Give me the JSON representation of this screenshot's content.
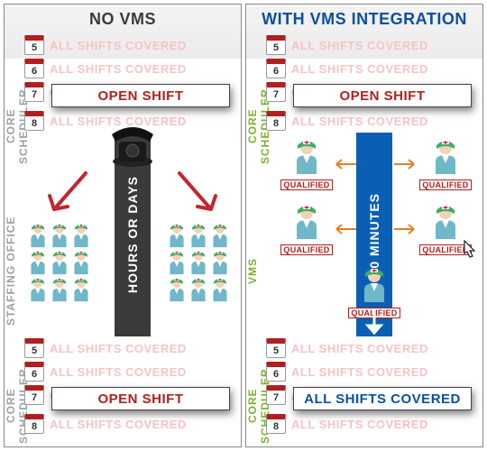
{
  "left": {
    "title": "NO VMS",
    "sideLabels": {
      "top": "CORE SCHEDULER",
      "mid": "STAFFING OFFICE",
      "bot": "CORE SCHEDULER"
    },
    "rowsTop": [
      {
        "day": "5",
        "text": "ALL SHIFTS COVERED"
      },
      {
        "day": "6",
        "text": "ALL SHIFTS COVERED"
      },
      {
        "day": "7",
        "text": "OPEN SHIFT"
      },
      {
        "day": "8",
        "text": "ALL SHIFTS COVERED"
      }
    ],
    "openLabel": "OPEN SHIFT",
    "pillarLabel": "HOURS OR DAYS",
    "rowsBot": [
      {
        "day": "5",
        "text": "ALL SHIFTS COVERED"
      },
      {
        "day": "6",
        "text": "ALL SHIFTS COVERED"
      },
      {
        "day": "7",
        "text": "OPEN SHIFT"
      },
      {
        "day": "8",
        "text": "ALL SHIFTS COVERED"
      }
    ],
    "openLabelBot": "OPEN SHIFT"
  },
  "right": {
    "title": "WITH VMS INTEGRATION",
    "sideLabels": {
      "top": "CORE SCHEDULER",
      "mid": "VMS",
      "bot": "CORE SCHEDULER"
    },
    "rowsTop": [
      {
        "day": "5",
        "text": "ALL SHIFTS COVERED"
      },
      {
        "day": "6",
        "text": "ALL SHIFTS COVERED"
      },
      {
        "day": "7",
        "text": "OPEN SHIFT"
      },
      {
        "day": "8",
        "text": "ALL SHIFTS COVERED"
      }
    ],
    "openLabel": "OPEN SHIFT",
    "pillarLabel": "10 MINUTES",
    "qualifiedLabel": "QUALIFIED",
    "rowsBot": [
      {
        "day": "5",
        "text": "ALL SHIFTS COVERED"
      },
      {
        "day": "6",
        "text": "ALL SHIFTS COVERED"
      },
      {
        "day": "7",
        "text": "ALL SHIFTS COVERED"
      },
      {
        "day": "8",
        "text": "ALL SHIFTS COVERED"
      }
    ],
    "coveredLabel": "ALL SHIFTS COVERED"
  },
  "icons": {
    "calendar": "calendar-icon",
    "phone": "phone-icon",
    "nurse": "nurse-icon",
    "redArrow": "red-arrow-icon",
    "orangeArrow": "orange-arrow-icon",
    "whiteArrow": "white-down-arrow-icon",
    "cursor": "cursor-icon"
  }
}
